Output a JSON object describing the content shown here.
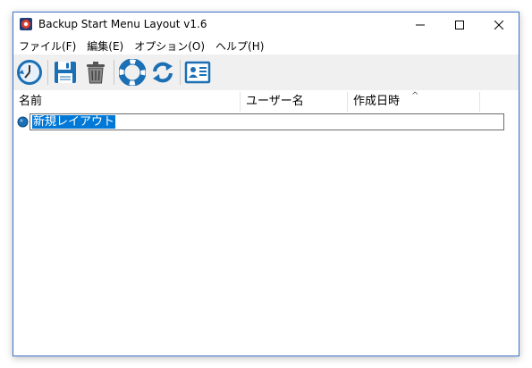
{
  "window": {
    "title": "Backup Start Menu Layout v1.6",
    "accent": "#3b73c8"
  },
  "menu": [
    {
      "label": "ファイル(F)"
    },
    {
      "label": "編集(E)"
    },
    {
      "label": "オプション(O)"
    },
    {
      "label": "ヘルプ(H)"
    }
  ],
  "toolbar_icons": [
    "backup-clock-icon",
    "save-icon",
    "trash-icon",
    "lifebuoy-icon",
    "refresh-icon",
    "id-card-icon"
  ],
  "list": {
    "columns": [
      "名前",
      "ユーザー名",
      "作成日時"
    ],
    "sort_indicator": "^",
    "editing_item": {
      "value": "新規レイアウト",
      "selected": true
    }
  },
  "colors": {
    "selection": "#0078d7",
    "icon_blue": "#1a6fb5"
  }
}
